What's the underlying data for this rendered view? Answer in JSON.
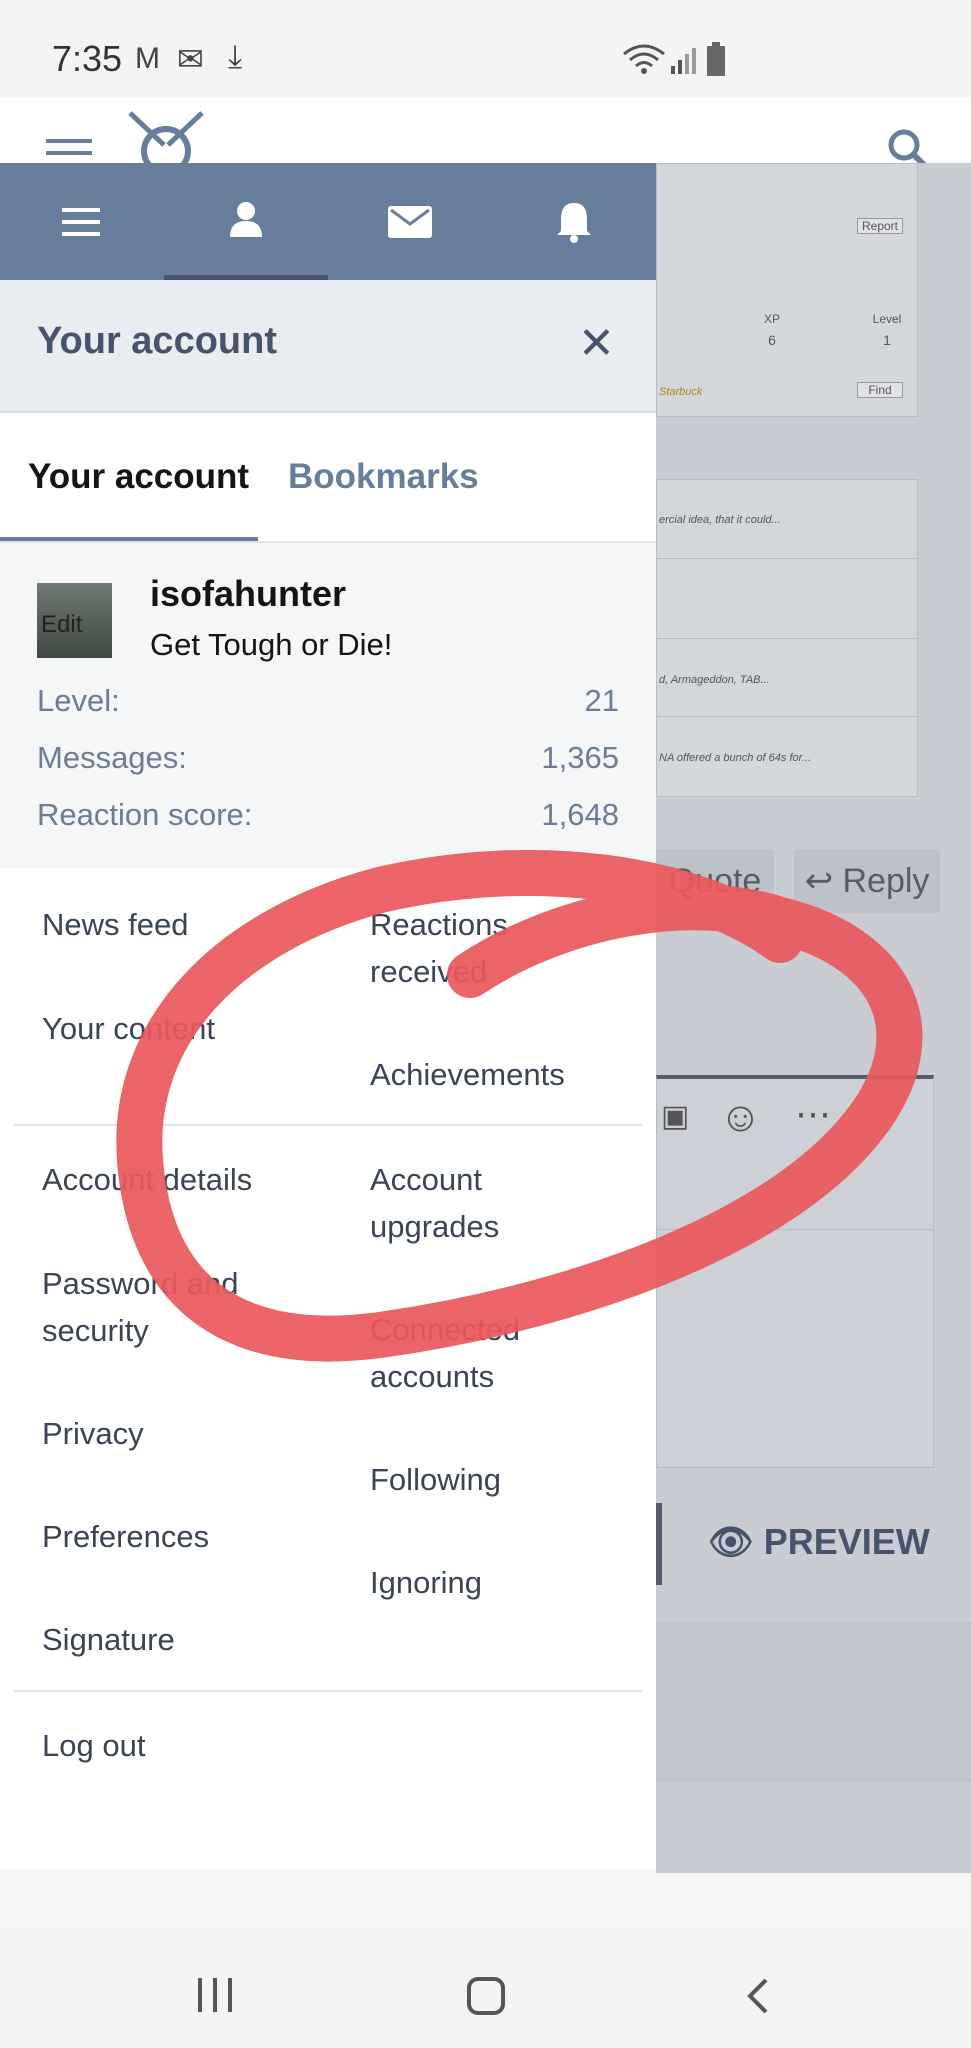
{
  "status_bar": {
    "time": "7:35"
  },
  "background_page": {
    "report_label": "Report",
    "xp_label": "XP",
    "xp_value": "6",
    "level_label": "Level",
    "level_value": "1",
    "starbuck_text": "Starbuck",
    "find_label": "Find",
    "snippet_1": "ercial idea, that it could...",
    "snippet_2": "d, Armageddon, TAB...",
    "snippet_3": "NA offered a bunch of 64s for...",
    "quote_label": "Quote",
    "reply_label": "Reply",
    "preview_label": "PREVIEW"
  },
  "drawer": {
    "header_title": "Your account",
    "tabs": [
      {
        "label": "Your account",
        "active": true
      },
      {
        "label": "Bookmarks",
        "active": false
      }
    ],
    "profile": {
      "avatar_text": "Edit",
      "username": "isofahunter",
      "tagline": "Get Tough or Die!",
      "stats": [
        {
          "label": "Level:",
          "value": "21"
        },
        {
          "label": "Messages:",
          "value": "1,365"
        },
        {
          "label": "Reaction score:",
          "value": "1,648"
        }
      ]
    },
    "menu": {
      "news_feed": "News feed",
      "reactions_received_1": "Reactions",
      "reactions_received_2": "received",
      "your_content": "Your content",
      "achievements": "Achievements",
      "account_details": "Account details",
      "account_upgrades_1": "Account",
      "account_upgrades_2": "upgrades",
      "password_security_1": "Password and",
      "password_security_2": "security",
      "connected_accounts_1": "Connected",
      "connected_accounts_2": "accounts",
      "privacy": "Privacy",
      "following": "Following",
      "preferences": "Preferences",
      "ignoring": "Ignoring",
      "signature": "Signature",
      "log_out": "Log out"
    }
  },
  "colors": {
    "nav_bar": "#667d9b",
    "header_text": "#47536a",
    "annotation_red": "#e8585d"
  }
}
